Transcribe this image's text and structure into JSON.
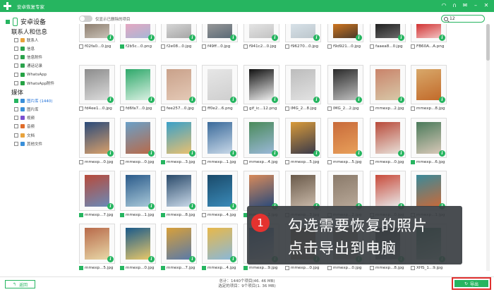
{
  "app": {
    "title": "安卓恢复专家"
  },
  "titlebar_icons": [
    "wifi-icon",
    "headset-icon",
    "mail-icon",
    "minimize-icon",
    "close-icon"
  ],
  "sidebar": {
    "device_name": "安卓设备",
    "section_contacts": "联系人和信息",
    "contacts_items": [
      {
        "label": "联系人",
        "color": "#e8a33d"
      },
      {
        "label": "信息",
        "color": "#2ba24c"
      },
      {
        "label": "信息附件",
        "color": "#2ba24c"
      },
      {
        "label": "通话记录",
        "color": "#2ba24c"
      },
      {
        "label": "WhatsApp",
        "color": "#25a244"
      },
      {
        "label": "WhatsApp附件",
        "color": "#25a244"
      }
    ],
    "section_media": "媒体",
    "media_items": [
      {
        "label": "图片库 (1440)",
        "color": "#3a8fd9",
        "active": true
      },
      {
        "label": "图片库",
        "color": "#3a8fd9",
        "active": false
      },
      {
        "label": "视频",
        "color": "#7b4fd0",
        "active": false
      },
      {
        "label": "音频",
        "color": "#e06c2a",
        "active": false
      },
      {
        "label": "文档",
        "color": "#e8a33d",
        "active": false
      },
      {
        "label": "其他文件",
        "color": "#3a8fd9",
        "active": false
      }
    ]
  },
  "toolbar": {
    "toggle_label": "仅显示已删除的项目"
  },
  "search": {
    "value": "12"
  },
  "thumbnails": [
    {
      "name": "f02fa0...0.jpg",
      "checked": false,
      "colors": [
        "#8a7a6a",
        "#c9c2b8"
      ]
    },
    {
      "name": "f2b5c...0.png",
      "checked": true,
      "colors": [
        "#e9a6c0",
        "#a7b7d6"
      ]
    },
    {
      "name": "f2e08...0.jpg",
      "checked": false,
      "colors": [
        "#d8d8d8",
        "#a6a6a6"
      ]
    },
    {
      "name": "f49ff...0.jpg",
      "checked": false,
      "colors": [
        "#9a9a9a",
        "#5b6a76"
      ]
    },
    {
      "name": "f941c2...0.jpg",
      "checked": false,
      "colors": [
        "#e6e6e6",
        "#c2c2c2"
      ]
    },
    {
      "name": "f96270...0.jpg",
      "checked": false,
      "colors": [
        "#d9e3ea",
        "#bcc6cc"
      ]
    },
    {
      "name": "f9d921...0.jpg",
      "checked": false,
      "colors": [
        "#d6781e",
        "#4b3a2a"
      ]
    },
    {
      "name": "faaea8...0.jpg",
      "checked": false,
      "colors": [
        "#1c1c1c",
        "#6a6a6a"
      ]
    },
    {
      "name": "FB60A...A.png",
      "checked": false,
      "colors": [
        "#d02a2a",
        "#f2c2c2"
      ]
    },
    {
      "name": "fd4ee1...0.jpg",
      "checked": false,
      "colors": [
        "#8c8c8c",
        "#dcdcdc"
      ]
    },
    {
      "name": "fd6fa7...0.jpg",
      "checked": false,
      "colors": [
        "#2ea86a",
        "#d9f0e2"
      ]
    },
    {
      "name": "fee257...0.jpg",
      "checked": false,
      "colors": [
        "#c9a18a",
        "#e4c9b6"
      ]
    },
    {
      "name": "ff0e2...6.png",
      "checked": false,
      "colors": [
        "#e6e6e6",
        "#cfcfcf"
      ]
    },
    {
      "name": "gif_ic...12.png",
      "checked": false,
      "colors": [
        "#111111",
        "#f0f0f0"
      ]
    },
    {
      "name": "IMG_2...8.jpg",
      "checked": false,
      "colors": [
        "#bcbcbc",
        "#e2e2e2"
      ]
    },
    {
      "name": "IMG_2...2.jpg",
      "checked": false,
      "colors": [
        "#2a2a2a",
        "#bfbfbf"
      ]
    },
    {
      "name": "mmexp...2.jpg",
      "checked": false,
      "colors": [
        "#c9836a",
        "#d8c8a8"
      ]
    },
    {
      "name": "mmexp...8.jpg",
      "checked": false,
      "colors": [
        "#d8a86a",
        "#c26a2a"
      ]
    },
    {
      "name": "mmexp...0.jpg",
      "checked": false,
      "colors": [
        "#2a4a7a",
        "#d9a06a"
      ]
    },
    {
      "name": "mmexp...0.jpg",
      "checked": false,
      "colors": [
        "#6aa0c8",
        "#b86a4a"
      ]
    },
    {
      "name": "mmexp...3.jpg",
      "checked": true,
      "colors": [
        "#3aa0c8",
        "#e8c070"
      ]
    },
    {
      "name": "mmexp...1.jpg",
      "checked": false,
      "colors": [
        "#3a6a9a",
        "#c8d8e8"
      ]
    },
    {
      "name": "mmexp...4.jpg",
      "checked": false,
      "colors": [
        "#4a8a5a",
        "#9ab8d8"
      ]
    },
    {
      "name": "mmexp...5.jpg",
      "checked": false,
      "colors": [
        "#d89a3a",
        "#3a3a4a"
      ]
    },
    {
      "name": "mmexp...5.jpg",
      "checked": false,
      "colors": [
        "#c86a3a",
        "#e8a05a"
      ]
    },
    {
      "name": "mmexp...0.jpg",
      "checked": false,
      "colors": [
        "#b84a3a",
        "#e8e0d8"
      ]
    },
    {
      "name": "mmexp...6.jpg",
      "checked": true,
      "colors": [
        "#4a7a5a",
        "#d8c8b8"
      ]
    },
    {
      "name": "mmexp...7.jpg",
      "checked": true,
      "colors": [
        "#b84a3a",
        "#6a8ab8"
      ]
    },
    {
      "name": "mmexp...1.jpg",
      "checked": true,
      "colors": [
        "#2a5a8a",
        "#a8c8d8"
      ]
    },
    {
      "name": "mmexp...8.jpg",
      "checked": true,
      "colors": [
        "#2a4a6a",
        "#c8d8e8"
      ]
    },
    {
      "name": "mmexp...4.jpg",
      "checked": false,
      "colors": [
        "#1a4a6a",
        "#3a8ab8"
      ]
    },
    {
      "name": "mmexp...2.jpg",
      "checked": true,
      "colors": [
        "#d88a5a",
        "#2a4a7a"
      ]
    },
    {
      "name": "mmexp...3.jpg",
      "checked": false,
      "colors": [
        "#6a5a4a",
        "#c8b8a8"
      ]
    },
    {
      "name": "mmexp...2.jpg",
      "checked": false,
      "colors": [
        "#8a7a6a",
        "#b8a898"
      ]
    },
    {
      "name": "mmexp...0.jpg",
      "checked": false,
      "colors": [
        "#c84a3a",
        "#e8e8e8"
      ]
    },
    {
      "name": "mmexp...1.jpg",
      "checked": false,
      "colors": [
        "#3a8a9a",
        "#c86a3a"
      ]
    },
    {
      "name": "mmexp...5.jpg",
      "checked": true,
      "colors": [
        "#b86a4a",
        "#e8d8a8"
      ]
    },
    {
      "name": "mmexp...0.jpg",
      "checked": true,
      "colors": [
        "#1a5a8a",
        "#e8c86a"
      ]
    },
    {
      "name": "mmexp...7.jpg",
      "checked": true,
      "colors": [
        "#d8a03a",
        "#5a7aa8"
      ]
    },
    {
      "name": "mmexp...4.jpg",
      "checked": true,
      "colors": [
        "#e8b84a",
        "#8ab8d8"
      ]
    },
    {
      "name": "mmexp...9.jpg",
      "checked": true,
      "colors": [
        "#2a6ab8",
        "#e8e8f0"
      ]
    },
    {
      "name": "mmexp...0.jpg",
      "checked": false,
      "colors": [
        "#8a6a4a",
        "#c8a888"
      ]
    },
    {
      "name": "mmexp...0.jpg",
      "checked": false,
      "colors": [
        "#9a8a7a",
        "#d8c8b8"
      ]
    },
    {
      "name": "mmexp...8.jpg",
      "checked": false,
      "colors": [
        "#3a3a3a",
        "#9a9a9a"
      ]
    },
    {
      "name": "XHS_1...9.jpg",
      "checked": false,
      "colors": [
        "#2a7a5a",
        "#c8e8d8"
      ]
    }
  ],
  "tip": {
    "number": "1",
    "line1": "勾选需要恢复的照片",
    "line2": "点击导出到电脑"
  },
  "footer": {
    "back_label": "返回",
    "total_text": "总计：1440个项目(46. 46 MB)",
    "selected_text": "选定的项目：9个项目(1. 36 MB)",
    "export_label": "导出"
  }
}
